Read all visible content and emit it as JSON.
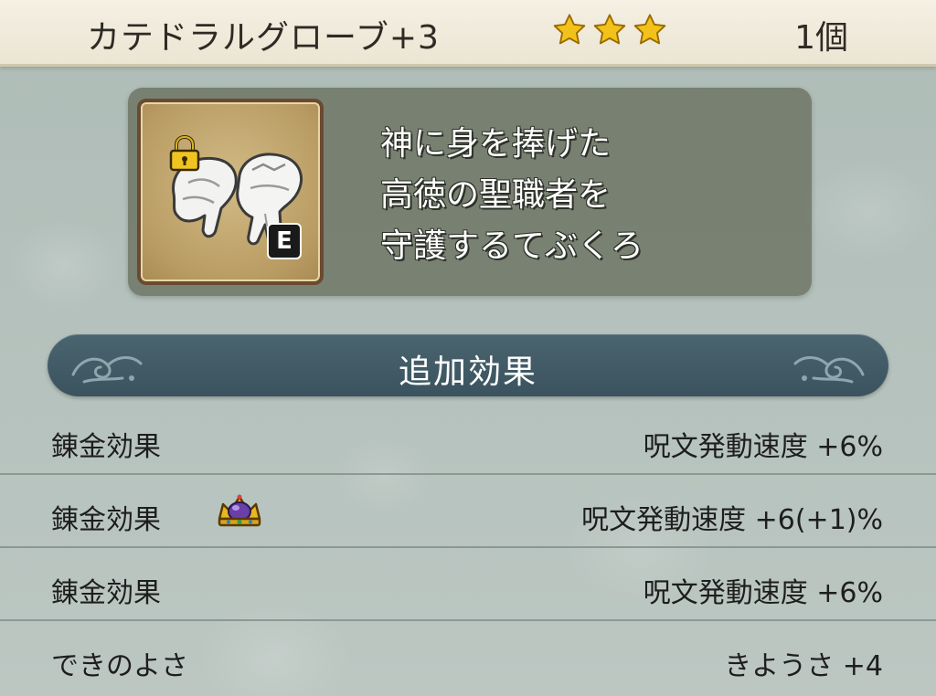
{
  "header": {
    "item_name": "カテドラルグローブ+3",
    "star_count": 3,
    "quantity": "1個"
  },
  "item": {
    "icon": "glove-icon",
    "locked": true,
    "equipped_badge": "E",
    "description_lines": [
      "神に身を捧げた",
      "高徳の聖職者を",
      "守護するてぶくろ"
    ]
  },
  "section": {
    "title": "追加効果"
  },
  "effects": [
    {
      "label": "錬金効果",
      "value": "呪文発動速度 +6%",
      "badge": null
    },
    {
      "label": "錬金効果",
      "value": "呪文発動速度 +6(+1)%",
      "badge": "crown-icon"
    },
    {
      "label": "錬金効果",
      "value": "呪文発動速度 +6%",
      "badge": null
    },
    {
      "label": "できのよさ",
      "value": "きようさ +4",
      "badge": null
    }
  ],
  "colors": {
    "star": "#f2c21b",
    "banner": "#3f5863",
    "panel": "#707868",
    "frame": "#6a4a30"
  }
}
